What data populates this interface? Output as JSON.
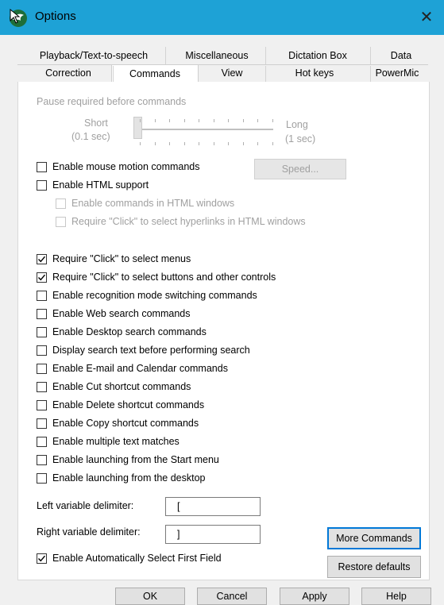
{
  "window": {
    "title": "Options",
    "close": "✕"
  },
  "tabs_top": [
    "Playback/Text-to-speech",
    "Miscellaneous",
    "Dictation Box",
    "Data"
  ],
  "tabs_bottom": [
    "Correction",
    "Commands",
    "View",
    "Hot keys",
    "PowerMic"
  ],
  "active_tab": "Commands",
  "pause": {
    "label": "Pause required before commands",
    "short_label": "Short",
    "short_value": "(0.1 sec)",
    "long_label": "Long",
    "long_value": "(1 sec)",
    "slider_level": 0
  },
  "speed_button": "Speed...",
  "options_top": [
    {
      "label": "Enable mouse motion commands",
      "checked": false,
      "disabled": false
    },
    {
      "label": "Enable HTML support",
      "checked": false,
      "disabled": false
    },
    {
      "label": "Enable commands in HTML windows",
      "checked": false,
      "disabled": true
    },
    {
      "label": "Require \"Click\" to select hyperlinks in HTML windows",
      "checked": false,
      "disabled": true
    }
  ],
  "options_main": [
    {
      "label": "Require \"Click\" to select menus",
      "checked": true
    },
    {
      "label": "Require \"Click\" to select buttons and other controls",
      "checked": true
    },
    {
      "label": "Enable recognition mode switching commands",
      "checked": false
    },
    {
      "label": "Enable Web search commands",
      "checked": false
    },
    {
      "label": "Enable Desktop search commands",
      "checked": false
    },
    {
      "label": "Display search text before performing search",
      "checked": false
    },
    {
      "label": "Enable E-mail and Calendar commands",
      "checked": false
    },
    {
      "label": "Enable Cut shortcut commands",
      "checked": false
    },
    {
      "label": "Enable Delete shortcut commands",
      "checked": false
    },
    {
      "label": "Enable Copy shortcut commands",
      "checked": false
    },
    {
      "label": "Enable multiple text matches",
      "checked": false
    },
    {
      "label": "Enable launching from the Start menu",
      "checked": false
    },
    {
      "label": "Enable launching from the desktop",
      "checked": false
    }
  ],
  "left_delim": {
    "label": "Left variable delimiter:",
    "value": "["
  },
  "right_delim": {
    "label": "Right variable delimiter:",
    "value": "]"
  },
  "auto_select": {
    "label": "Enable Automatically Select First Field",
    "checked": true
  },
  "more_commands_button": "More Commands",
  "restore_defaults_button": "Restore defaults",
  "footer": {
    "ok": "OK",
    "cancel": "Cancel",
    "apply": "Apply",
    "help": "Help"
  },
  "colors": {
    "titlebar": "#1ea2d6",
    "focus": "#0078d7"
  }
}
